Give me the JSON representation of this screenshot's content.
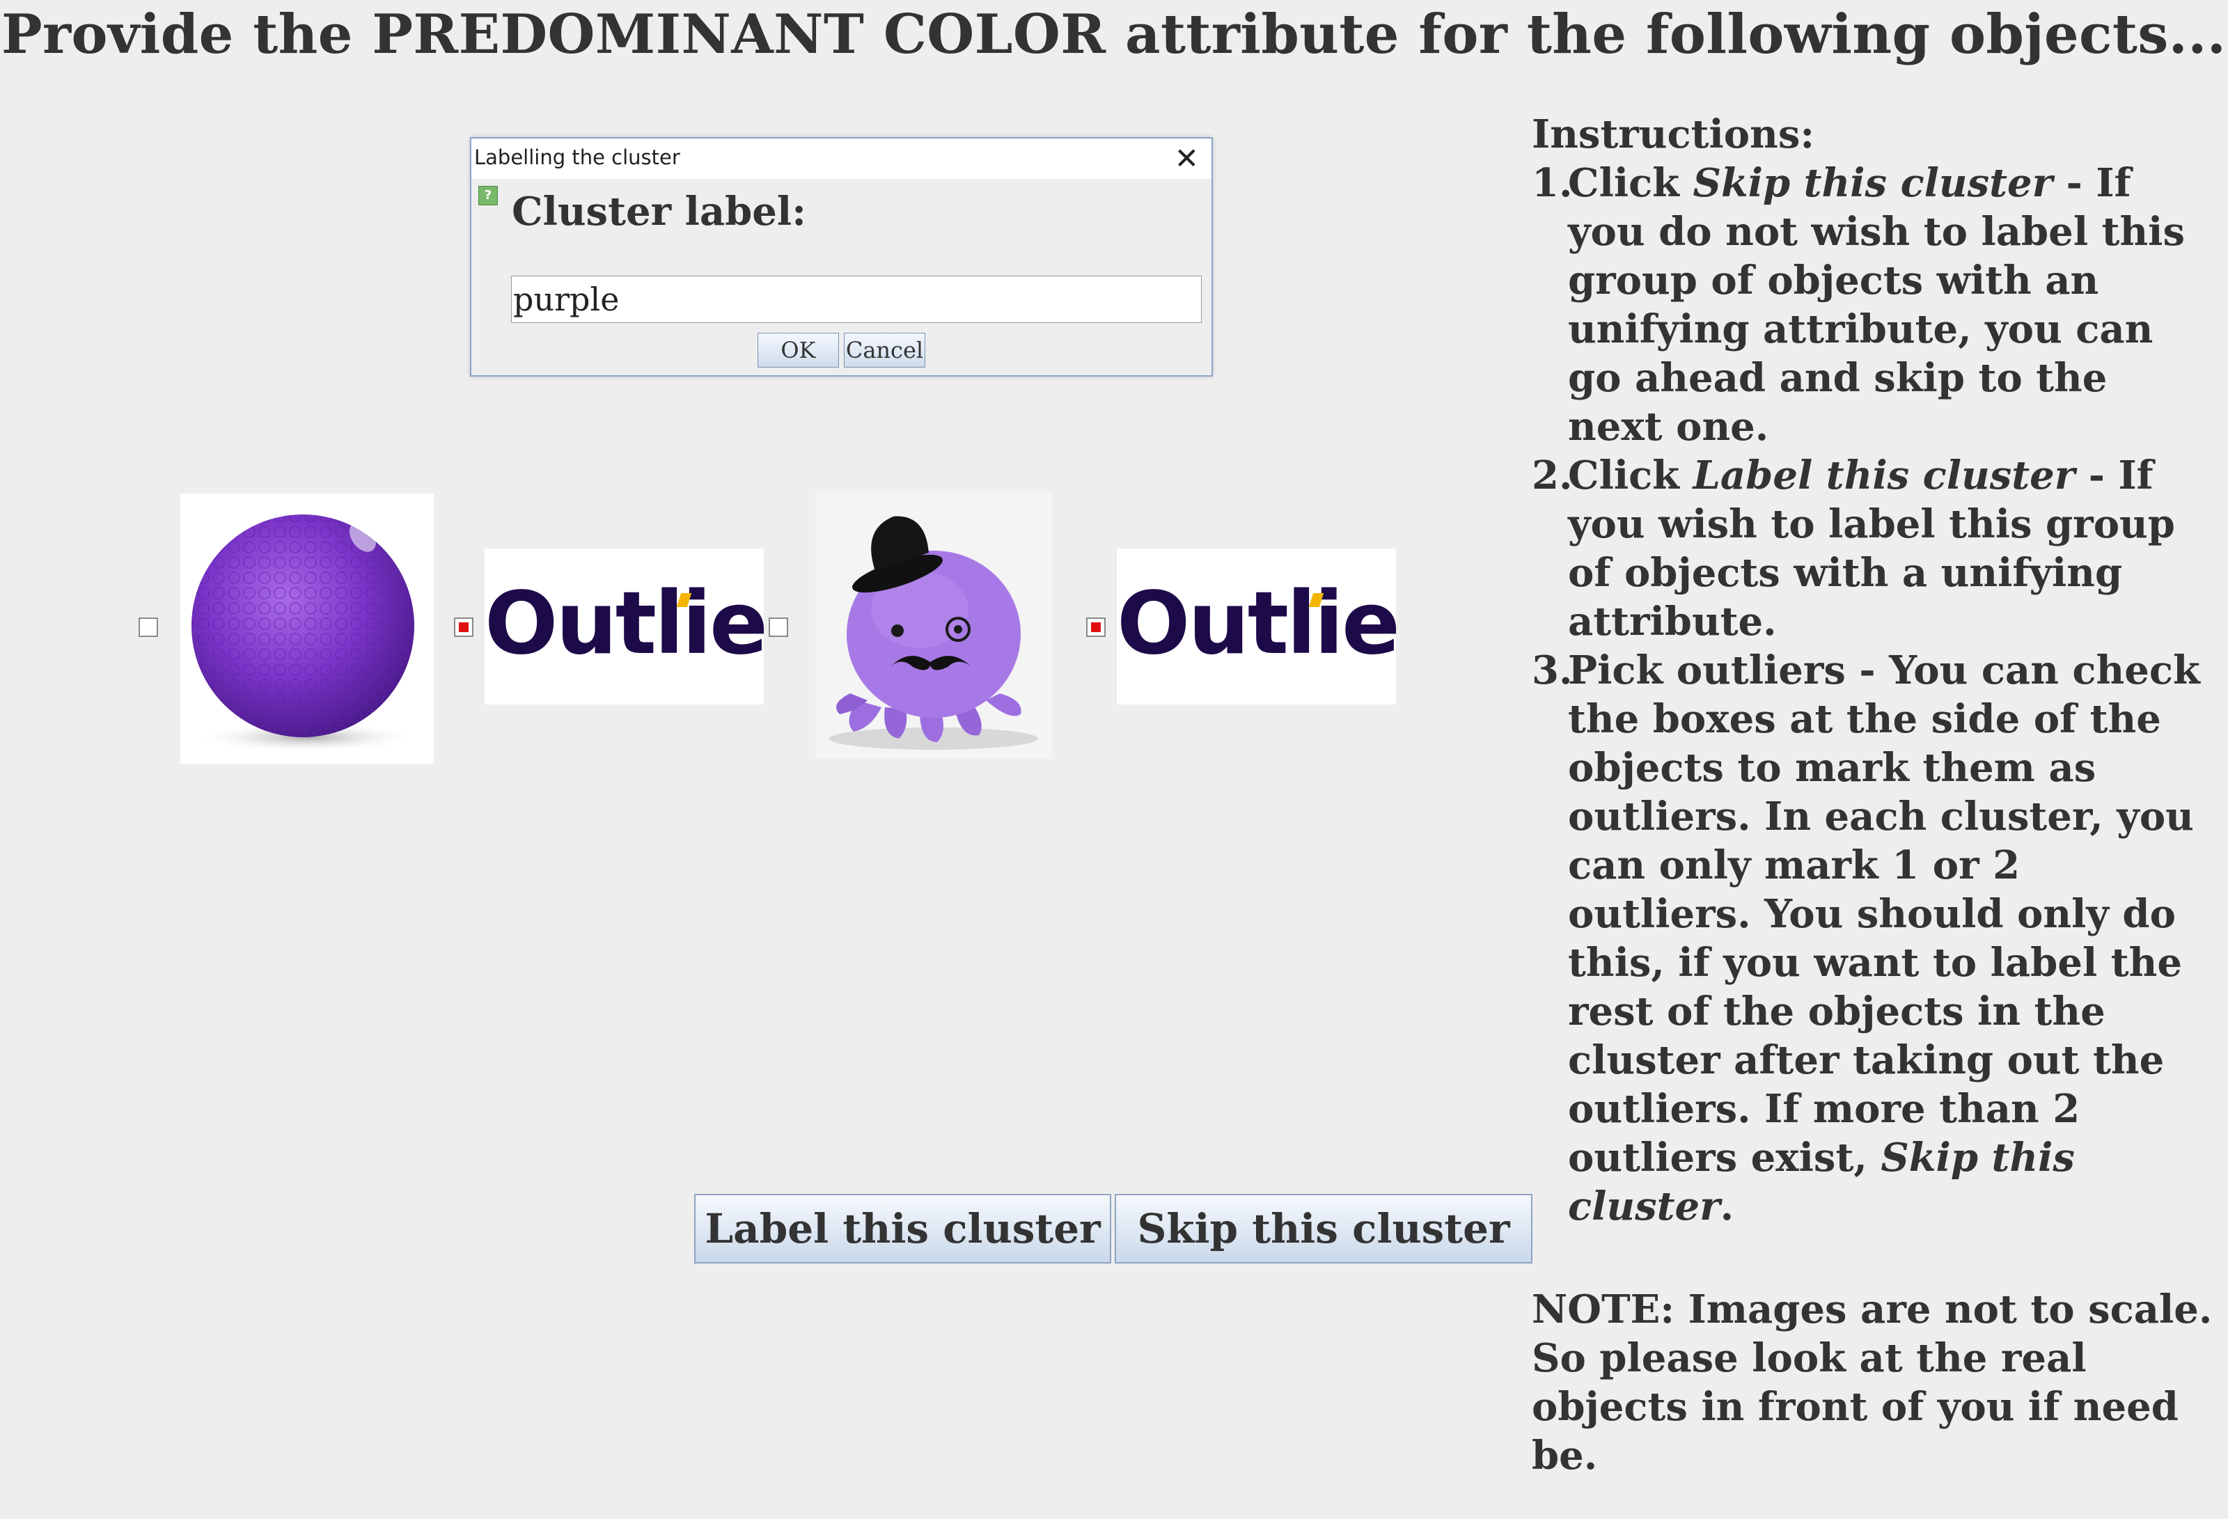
{
  "page_title": "Provide the PREDOMINANT COLOR attribute for the following objects...",
  "dialog": {
    "title": "Labelling the cluster",
    "close_glyph": "✕",
    "question_glyph": "?",
    "prompt": "Cluster label:",
    "input_value": "purple",
    "ok_label": "OK",
    "cancel_label": "Cancel"
  },
  "objects": [
    {
      "kind": "purple golf ball",
      "checked": false
    },
    {
      "kind": "outlier placeholder",
      "text": "Outlier",
      "checked": true
    },
    {
      "kind": "purple octopus plush with black top hat",
      "checked": false
    },
    {
      "kind": "outlier placeholder",
      "text": "Outlier",
      "checked": true
    }
  ],
  "instructions": {
    "heading": "Instructions:",
    "items": [
      {
        "num": "1.",
        "pre": "Click ",
        "em": "Skip this cluster",
        "post": " - If you do not wish to label this group of objects with an unifying attribute, you can go ahead and skip to the next one."
      },
      {
        "num": "2.",
        "pre": "Click ",
        "em": "Label this cluster",
        "post": " - If you wish to label this group of objects with a unifying attribute."
      },
      {
        "num": "3.",
        "pre": "Pick outliers - You can check the boxes at the side of the objects to mark them as outliers. In each cluster, you can only mark 1 or 2 outliers. You should only do this, if you want to label the rest of the objects in the cluster after taking out the outliers. If more than 2 outliers exist, ",
        "em": "Skip this cluster",
        "post": "."
      }
    ],
    "note": "NOTE: Images are not to scale. So please look at the real objects in front of you if need be."
  },
  "buttons": {
    "label_cluster": "Label this cluster",
    "skip_cluster": "Skip this cluster"
  },
  "colors": {
    "background": "#eeeeee",
    "checked_red": "#e01010",
    "outlier_text": "#1d0a48",
    "outlier_dot": "#f5b400",
    "purple": "#8a3fd1"
  }
}
